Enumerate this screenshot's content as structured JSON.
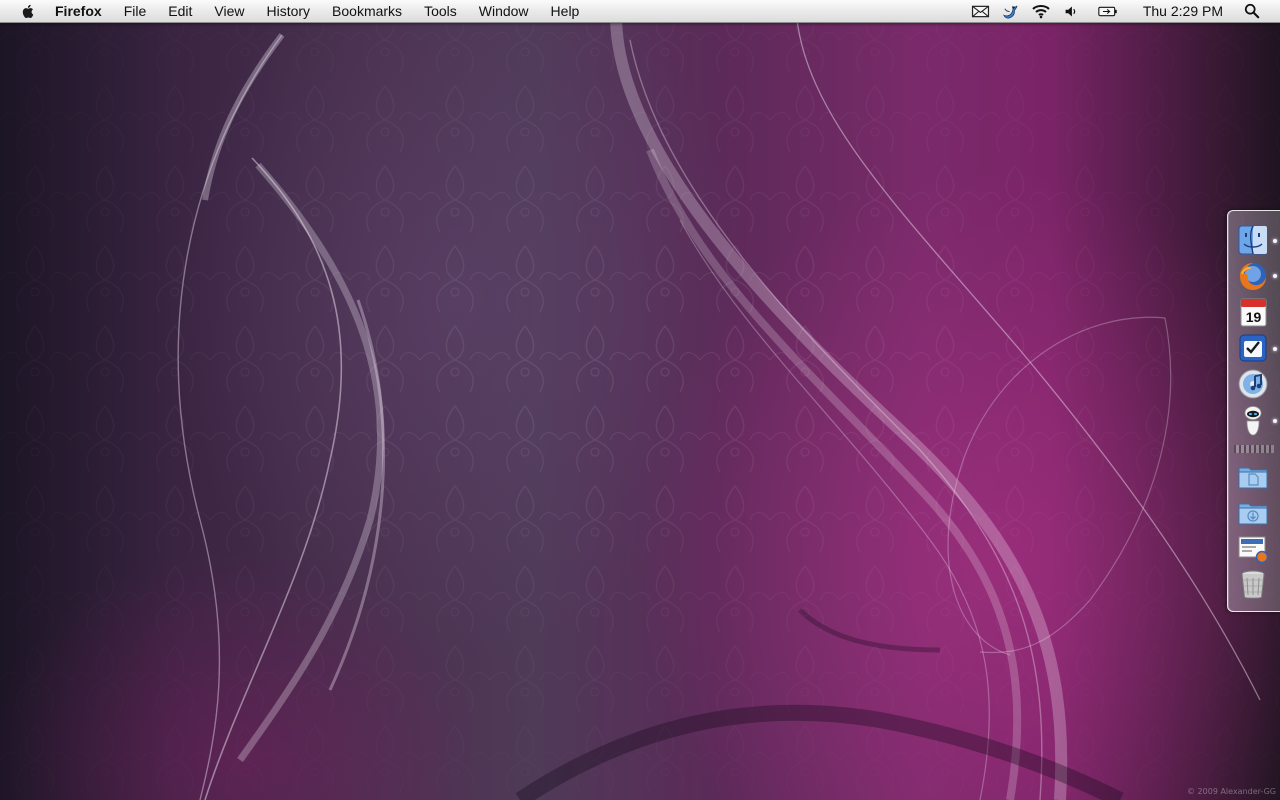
{
  "menubar": {
    "app_name": "Firefox",
    "items": [
      "File",
      "Edit",
      "View",
      "History",
      "Bookmarks",
      "Tools",
      "Window",
      "Help"
    ],
    "status_icons": [
      "mail-icon",
      "twitter-bird-icon",
      "wifi-icon",
      "volume-icon",
      "battery-icon"
    ],
    "clock": "Thu 2:29 PM",
    "search_icon": "spotlight-icon"
  },
  "dock": {
    "items": [
      {
        "name": "finder",
        "running": true
      },
      {
        "name": "firefox",
        "running": true
      },
      {
        "name": "ical",
        "running": false,
        "date_label": "19"
      },
      {
        "name": "things",
        "running": true
      },
      {
        "name": "itunes",
        "running": false
      },
      {
        "name": "eve-robot",
        "running": true
      },
      {
        "name": "documents-folder",
        "running": false
      },
      {
        "name": "downloads-folder",
        "running": false
      },
      {
        "name": "screenshot-stack",
        "running": false
      },
      {
        "name": "trash",
        "running": false
      }
    ]
  },
  "desktop": {
    "watermark": "© 2009 Alexander-GG"
  },
  "colors": {
    "wallpaper_left": "#1c1525",
    "wallpaper_center": "#4f3a58",
    "wallpaper_right": "#7a2467"
  }
}
